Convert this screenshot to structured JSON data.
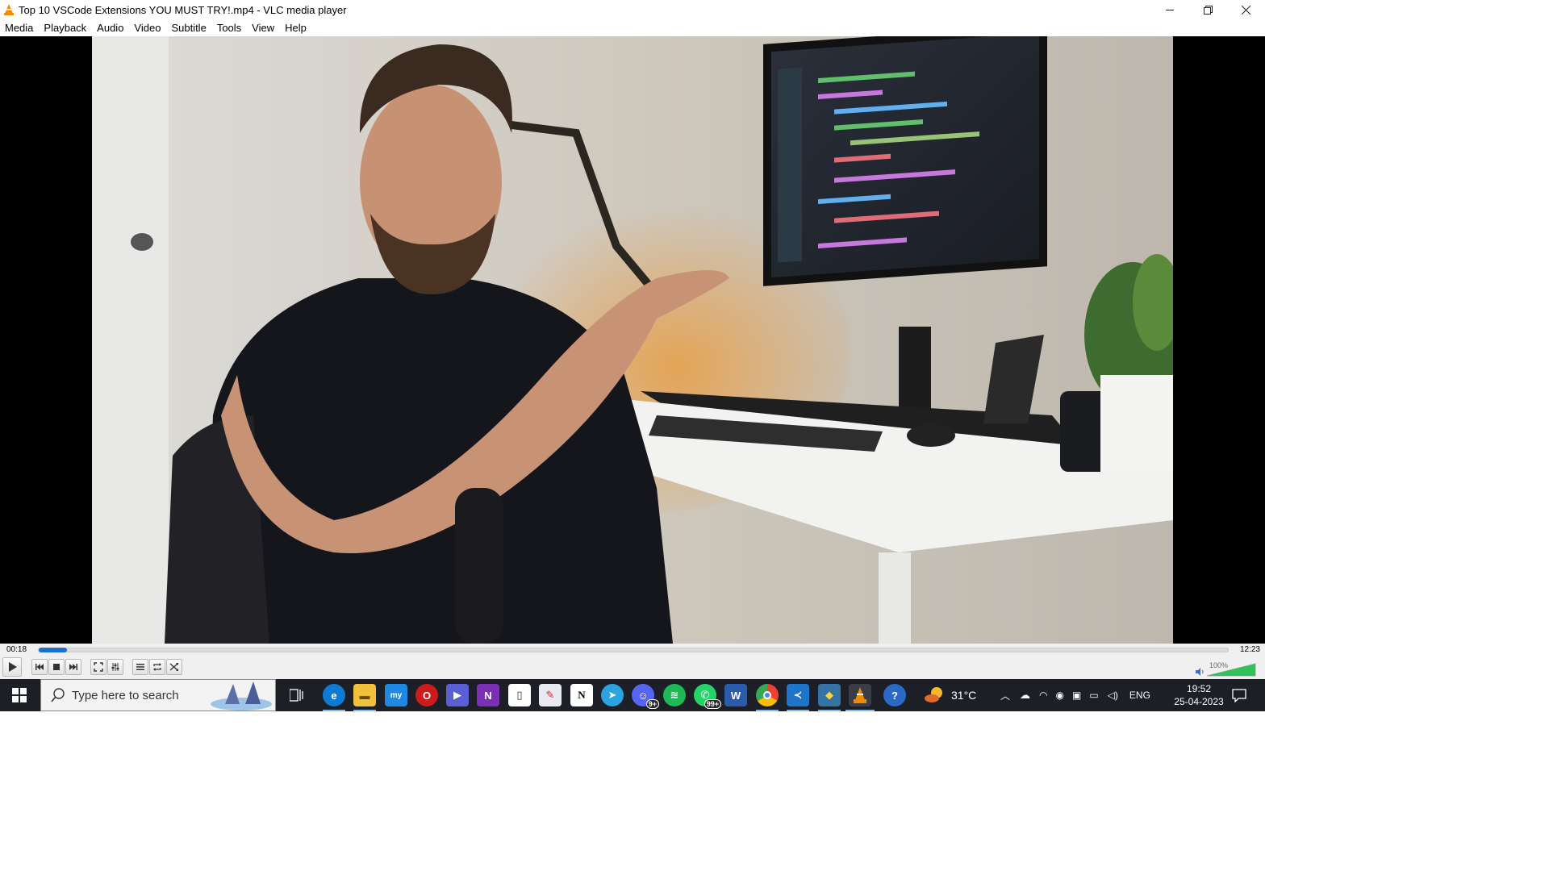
{
  "window": {
    "title": "Top 10 VSCode Extensions YOU MUST TRY!.mp4 - VLC media player",
    "controls": [
      "minimize-icon",
      "restore-icon",
      "close-icon"
    ]
  },
  "menu": [
    "Media",
    "Playback",
    "Audio",
    "Video",
    "Subtitle",
    "Tools",
    "View",
    "Help"
  ],
  "player": {
    "elapsed": "00:18",
    "total": "12:23",
    "progress_percent": 2.4,
    "volume_label": "100%",
    "volume_level": 1.0,
    "accent_color": "#1e6fd0",
    "buttons": [
      "play-icon",
      "previous-icon",
      "stop-icon",
      "next-icon",
      "fullscreen-icon",
      "extended-settings-icon",
      "playlist-icon",
      "loop-icon",
      "random-icon"
    ]
  },
  "taskbar": {
    "search_placeholder": "Type here to search",
    "apps": [
      "task-view-icon",
      "edge-icon",
      "file-explorer-icon",
      "mylp-icon",
      "opera-icon",
      "prime-video-icon",
      "onenote-icon",
      "notepad-icon",
      "paint-icon",
      "notion-icon",
      "telegram-icon",
      "discord-icon",
      "spotify-icon",
      "whatsapp-icon",
      "word-icon",
      "chrome-icon",
      "vscode-icon",
      "python-icon",
      "vlc-icon",
      "help-icon"
    ],
    "discord_badge": "9+",
    "whatsapp_badge": "99+",
    "weather": "31°C",
    "language": "ENG",
    "time": "19:52",
    "date": "25-04-2023"
  }
}
